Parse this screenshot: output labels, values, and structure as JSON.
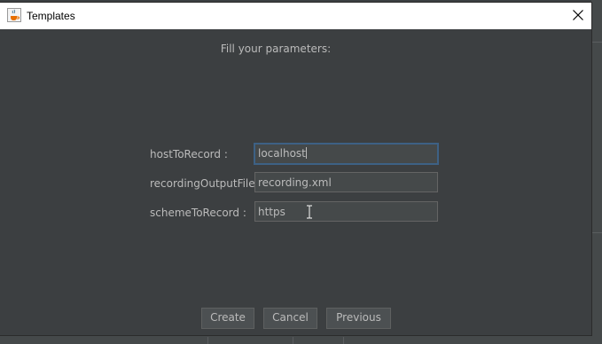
{
  "window": {
    "title": "Templates",
    "icons": {
      "app": "java-cup-icon",
      "close": "close-icon"
    }
  },
  "form": {
    "instruction": "Fill your parameters:",
    "fields": [
      {
        "label": "hostToRecord :",
        "value": "localhost"
      },
      {
        "label": "recordingOutputFile :",
        "value": "recording.xml"
      },
      {
        "label": "schemeToRecord :",
        "value": "https"
      }
    ]
  },
  "buttons": {
    "create": "Create",
    "cancel": "Cancel",
    "previous": "Previous"
  },
  "colors": {
    "background": "#3c3f41",
    "field_background": "#45494a",
    "text": "#bbbbbb",
    "focus_border": "#3d6185"
  }
}
